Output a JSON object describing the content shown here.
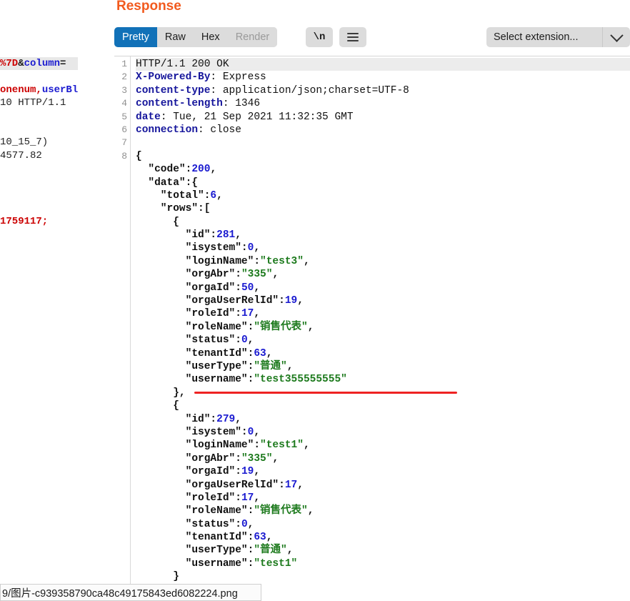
{
  "top_tabs": {
    "segments": [
      {
        "label": "",
        "active": true,
        "width": 46
      },
      {
        "label": "",
        "active": false,
        "width": 42
      },
      {
        "label": "",
        "active": false,
        "width": 46
      }
    ]
  },
  "left_request_pane": {
    "name": "request-pane",
    "clipped_lines": [
      {
        "highlight": true,
        "parts": [
          {
            "t": "%7D",
            "c": "c-red"
          },
          {
            "t": "&",
            "c": "c-black"
          },
          {
            "t": "column",
            "c": "c-blue"
          },
          {
            "t": "=",
            "c": "c-black"
          }
        ]
      },
      {
        "highlight": false,
        "parts": []
      },
      {
        "highlight": false,
        "parts": [
          {
            "t": "onenum,",
            "c": "c-red"
          },
          {
            "t": "userBl",
            "c": "c-blue"
          }
        ]
      },
      {
        "highlight": false,
        "parts": [
          {
            "t": "10 HTTP/1.1",
            "c": "c-dark"
          }
        ]
      },
      {
        "highlight": false,
        "parts": []
      },
      {
        "highlight": false,
        "parts": []
      },
      {
        "highlight": false,
        "parts": [
          {
            "t": "10_15_7)",
            "c": "c-dark"
          }
        ]
      },
      {
        "highlight": false,
        "parts": [
          {
            "t": "4577.82",
            "c": "c-dark"
          }
        ]
      },
      {
        "highlight": false,
        "parts": []
      },
      {
        "highlight": false,
        "parts": []
      },
      {
        "highlight": false,
        "parts": []
      },
      {
        "highlight": false,
        "parts": []
      },
      {
        "highlight": false,
        "parts": [
          {
            "t": "1759117;",
            "c": "c-red"
          }
        ]
      }
    ]
  },
  "response": {
    "title": "Response",
    "view_tabs": [
      {
        "label": "Pretty",
        "state": "active"
      },
      {
        "label": "Raw",
        "state": "normal"
      },
      {
        "label": "Hex",
        "state": "normal"
      },
      {
        "label": "Render",
        "state": "disabled"
      }
    ],
    "newline_button": "\\n",
    "menu_button_icon": "hamburger-icon",
    "extension_select": {
      "value": "Select extension...",
      "caret_icon": "chevron-down-icon"
    },
    "line_numbers": [
      "1",
      "2",
      "3",
      "4",
      "5",
      "6",
      "7",
      "8"
    ],
    "code_lines": [
      {
        "highlight": true,
        "parts": [
          {
            "t": "HTTP/1.1 200 OK",
            "c": "status-line"
          }
        ]
      },
      {
        "highlight": false,
        "parts": [
          {
            "t": "X-Powered-By",
            "c": "hdr-name"
          },
          {
            "t": ": Express",
            "c": "hdr-val"
          }
        ]
      },
      {
        "highlight": false,
        "parts": [
          {
            "t": "content-type",
            "c": "hdr-name"
          },
          {
            "t": ": application/json;charset=UTF-8",
            "c": "hdr-val"
          }
        ]
      },
      {
        "highlight": false,
        "parts": [
          {
            "t": "content-length",
            "c": "hdr-name"
          },
          {
            "t": ": 1346",
            "c": "hdr-val"
          }
        ]
      },
      {
        "highlight": false,
        "parts": [
          {
            "t": "date",
            "c": "hdr-name"
          },
          {
            "t": ": Tue, 21 Sep 2021 11:32:35 GMT",
            "c": "hdr-val"
          }
        ]
      },
      {
        "highlight": false,
        "parts": [
          {
            "t": "connection",
            "c": "hdr-name"
          },
          {
            "t": ": close",
            "c": "hdr-val"
          }
        ]
      },
      {
        "highlight": false,
        "parts": []
      },
      {
        "highlight": false,
        "parts": [
          {
            "t": "{",
            "c": "j-punc"
          }
        ]
      },
      {
        "highlight": false,
        "parts": [
          {
            "t": "  \"code\":",
            "c": "j-key"
          },
          {
            "t": "200",
            "c": "j-num"
          },
          {
            "t": ",",
            "c": "j-punc"
          }
        ]
      },
      {
        "highlight": false,
        "parts": [
          {
            "t": "  \"data\":{",
            "c": "j-key"
          }
        ]
      },
      {
        "highlight": false,
        "parts": [
          {
            "t": "    \"total\":",
            "c": "j-key"
          },
          {
            "t": "6",
            "c": "j-num"
          },
          {
            "t": ",",
            "c": "j-punc"
          }
        ]
      },
      {
        "highlight": false,
        "parts": [
          {
            "t": "    \"rows\":[",
            "c": "j-key"
          }
        ]
      },
      {
        "highlight": false,
        "parts": [
          {
            "t": "      {",
            "c": "j-punc"
          }
        ]
      },
      {
        "highlight": false,
        "parts": [
          {
            "t": "        \"id\":",
            "c": "j-key"
          },
          {
            "t": "281",
            "c": "j-num"
          },
          {
            "t": ",",
            "c": "j-punc"
          }
        ]
      },
      {
        "highlight": false,
        "parts": [
          {
            "t": "        \"isystem\":",
            "c": "j-key"
          },
          {
            "t": "0",
            "c": "j-num"
          },
          {
            "t": ",",
            "c": "j-punc"
          }
        ]
      },
      {
        "highlight": false,
        "parts": [
          {
            "t": "        \"loginName\":",
            "c": "j-key"
          },
          {
            "t": "\"test3\"",
            "c": "j-str"
          },
          {
            "t": ",",
            "c": "j-punc"
          }
        ]
      },
      {
        "highlight": false,
        "parts": [
          {
            "t": "        \"orgAbr\":",
            "c": "j-key"
          },
          {
            "t": "\"335\"",
            "c": "j-str"
          },
          {
            "t": ",",
            "c": "j-punc"
          }
        ]
      },
      {
        "highlight": false,
        "parts": [
          {
            "t": "        \"orgaId\":",
            "c": "j-key"
          },
          {
            "t": "50",
            "c": "j-num"
          },
          {
            "t": ",",
            "c": "j-punc"
          }
        ]
      },
      {
        "highlight": false,
        "parts": [
          {
            "t": "        \"orgaUserRelId\":",
            "c": "j-key"
          },
          {
            "t": "19",
            "c": "j-num"
          },
          {
            "t": ",",
            "c": "j-punc"
          }
        ]
      },
      {
        "highlight": false,
        "parts": [
          {
            "t": "        \"roleId\":",
            "c": "j-key"
          },
          {
            "t": "17",
            "c": "j-num"
          },
          {
            "t": ",",
            "c": "j-punc"
          }
        ]
      },
      {
        "highlight": false,
        "parts": [
          {
            "t": "        \"roleName\":",
            "c": "j-key"
          },
          {
            "t": "\"销售代表\"",
            "c": "j-str"
          },
          {
            "t": ",",
            "c": "j-punc"
          }
        ]
      },
      {
        "highlight": false,
        "parts": [
          {
            "t": "        \"status\":",
            "c": "j-key"
          },
          {
            "t": "0",
            "c": "j-num"
          },
          {
            "t": ",",
            "c": "j-punc"
          }
        ]
      },
      {
        "highlight": false,
        "parts": [
          {
            "t": "        \"tenantId\":",
            "c": "j-key"
          },
          {
            "t": "63",
            "c": "j-num"
          },
          {
            "t": ",",
            "c": "j-punc"
          }
        ]
      },
      {
        "highlight": false,
        "parts": [
          {
            "t": "        \"userType\":",
            "c": "j-key"
          },
          {
            "t": "\"普通\"",
            "c": "j-str"
          },
          {
            "t": ",",
            "c": "j-punc"
          }
        ]
      },
      {
        "highlight": false,
        "parts": [
          {
            "t": "        \"username\":",
            "c": "j-key"
          },
          {
            "t": "\"test355555555\"",
            "c": "j-str"
          }
        ]
      },
      {
        "highlight": false,
        "parts": [
          {
            "t": "      },",
            "c": "j-punc"
          }
        ]
      },
      {
        "highlight": false,
        "parts": [
          {
            "t": "      {",
            "c": "j-punc"
          }
        ]
      },
      {
        "highlight": false,
        "parts": [
          {
            "t": "        \"id\":",
            "c": "j-key"
          },
          {
            "t": "279",
            "c": "j-num"
          },
          {
            "t": ",",
            "c": "j-punc"
          }
        ]
      },
      {
        "highlight": false,
        "parts": [
          {
            "t": "        \"isystem\":",
            "c": "j-key"
          },
          {
            "t": "0",
            "c": "j-num"
          },
          {
            "t": ",",
            "c": "j-punc"
          }
        ]
      },
      {
        "highlight": false,
        "parts": [
          {
            "t": "        \"loginName\":",
            "c": "j-key"
          },
          {
            "t": "\"test1\"",
            "c": "j-str"
          },
          {
            "t": ",",
            "c": "j-punc"
          }
        ]
      },
      {
        "highlight": false,
        "parts": [
          {
            "t": "        \"orgAbr\":",
            "c": "j-key"
          },
          {
            "t": "\"335\"",
            "c": "j-str"
          },
          {
            "t": ",",
            "c": "j-punc"
          }
        ]
      },
      {
        "highlight": false,
        "parts": [
          {
            "t": "        \"orgaId\":",
            "c": "j-key"
          },
          {
            "t": "19",
            "c": "j-num"
          },
          {
            "t": ",",
            "c": "j-punc"
          }
        ]
      },
      {
        "highlight": false,
        "parts": [
          {
            "t": "        \"orgaUserRelId\":",
            "c": "j-key"
          },
          {
            "t": "17",
            "c": "j-num"
          },
          {
            "t": ",",
            "c": "j-punc"
          }
        ]
      },
      {
        "highlight": false,
        "parts": [
          {
            "t": "        \"roleId\":",
            "c": "j-key"
          },
          {
            "t": "17",
            "c": "j-num"
          },
          {
            "t": ",",
            "c": "j-punc"
          }
        ]
      },
      {
        "highlight": false,
        "parts": [
          {
            "t": "        \"roleName\":",
            "c": "j-key"
          },
          {
            "t": "\"销售代表\"",
            "c": "j-str"
          },
          {
            "t": ",",
            "c": "j-punc"
          }
        ]
      },
      {
        "highlight": false,
        "parts": [
          {
            "t": "        \"status\":",
            "c": "j-key"
          },
          {
            "t": "0",
            "c": "j-num"
          },
          {
            "t": ",",
            "c": "j-punc"
          }
        ]
      },
      {
        "highlight": false,
        "parts": [
          {
            "t": "        \"tenantId\":",
            "c": "j-key"
          },
          {
            "t": "63",
            "c": "j-num"
          },
          {
            "t": ",",
            "c": "j-punc"
          }
        ]
      },
      {
        "highlight": false,
        "parts": [
          {
            "t": "        \"userType\":",
            "c": "j-key"
          },
          {
            "t": "\"普通\"",
            "c": "j-str"
          },
          {
            "t": ",",
            "c": "j-punc"
          }
        ]
      },
      {
        "highlight": false,
        "parts": [
          {
            "t": "        \"username\":",
            "c": "j-key"
          },
          {
            "t": "\"test1\"",
            "c": "j-str"
          }
        ]
      },
      {
        "highlight": false,
        "parts": [
          {
            "t": "      }",
            "c": "j-punc"
          }
        ]
      }
    ]
  },
  "annotation": {
    "type": "red-underline",
    "color": "#ee2222",
    "targets": "username value test355555555"
  },
  "status_bar": {
    "filename": "9/图片-c939358790ca48c49175843ed6082224.png"
  },
  "splitter": {
    "name": "pane-splitter",
    "handle_icon": "drag-dots-icon"
  }
}
